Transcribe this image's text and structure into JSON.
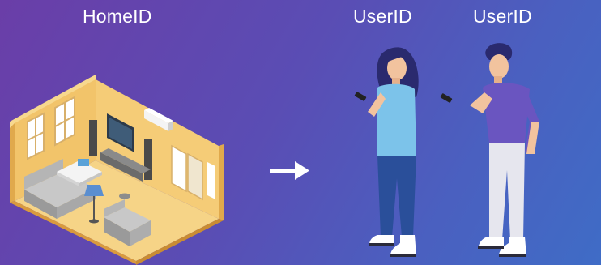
{
  "labels": {
    "home": "HomeID",
    "user_1": "UserID",
    "user_2": "UserID"
  },
  "icons": {
    "arrow": "arrow-right-icon"
  },
  "colors": {
    "background_start": "#6a3ea8",
    "background_end": "#3f6cc6",
    "room_wall": "#f2c46a",
    "room_floor": "#f6d487",
    "woman_shirt": "#7cc3ea",
    "woman_pants": "#2a4f9a",
    "man_shirt": "#6a55c0",
    "man_pants": "#e6e6ee"
  }
}
